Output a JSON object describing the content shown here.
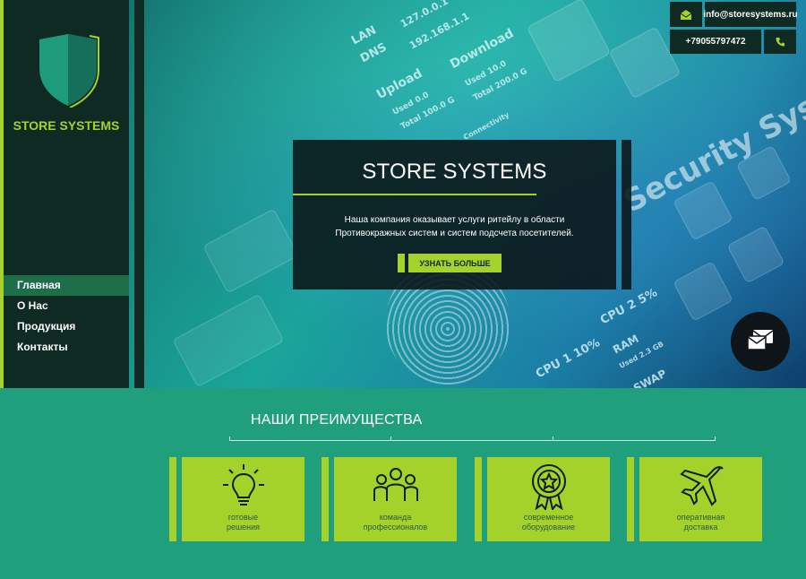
{
  "brand": {
    "name": "STORE SYSTEMS"
  },
  "nav": {
    "items": [
      "Главная",
      "О Нас",
      "Продукция",
      "Контакты"
    ],
    "active_index": 0
  },
  "contacts": {
    "email": "info@storesystems.ru",
    "phone": "+79055797472"
  },
  "hero": {
    "title": "STORE SYSTEMS",
    "description": "Наша компания оказывает услуги ритейлу в области Противокражных систем и систем подсчета посетителей.",
    "button_label": "УЗНАТЬ БОЛЬШЕ",
    "background_text": {
      "lan": "LAN",
      "dns": "DNS",
      "ip1": "127.0.0.1",
      "ip2": "192.168.1.1",
      "upload": "Upload",
      "download": "Download",
      "used_up": "Used 0.0",
      "total_up": "Total 100.0 G",
      "used_down": "Used 10.0",
      "total_down": "Total 200.0 G",
      "connectivity": "Connectivity",
      "security": "Security System",
      "cpu1": "CPU 1 10%",
      "cpu2": "CPU 2 5%",
      "ram": "RAM",
      "ram_used": "Used 2.3 GB",
      "swap": "SWAP"
    }
  },
  "advantages": {
    "title": "НАШИ ПРЕИМУЩЕСТВА",
    "items": [
      {
        "icon": "lightbulb-icon",
        "label_line1": "готовые",
        "label_line2": "решения"
      },
      {
        "icon": "team-icon",
        "label_line1": "команда",
        "label_line2": "профессионалов"
      },
      {
        "icon": "award-icon",
        "label_line1": "современное",
        "label_line2": "оборудование"
      },
      {
        "icon": "airplane-icon",
        "label_line1": "оперативная",
        "label_line2": "доставка"
      }
    ]
  },
  "colors": {
    "accent": "#a5d12b",
    "dark": "#0f2a22",
    "section_bg": "#1f9f7c"
  }
}
